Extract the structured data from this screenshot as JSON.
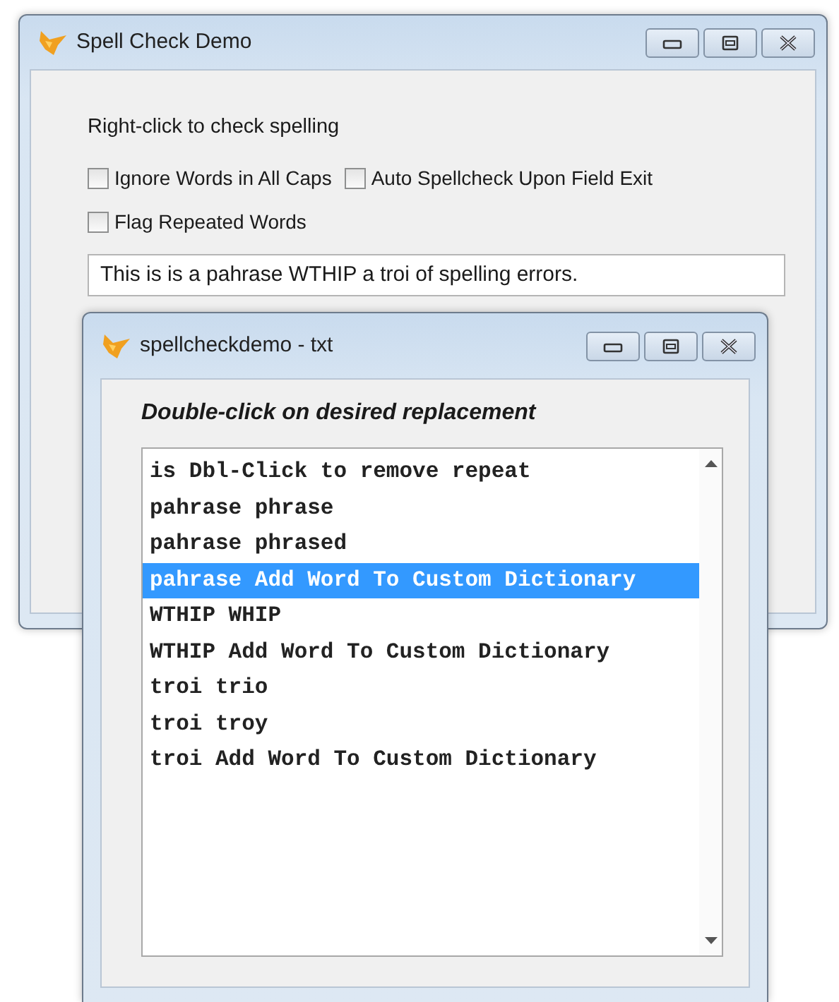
{
  "main_window": {
    "title": "Spell Check Demo",
    "instruction": "Right-click to check spelling",
    "options": [
      {
        "label": "Ignore Words in All Caps",
        "checked": false
      },
      {
        "label": "Auto Spellcheck Upon Field Exit",
        "checked": false
      },
      {
        "label": "Flag Repeated Words",
        "checked": false
      }
    ],
    "text_field": {
      "value": "This is is a pahrase WTHIP a troi of spelling errors."
    }
  },
  "dialog": {
    "title": "spellcheckdemo - txt",
    "heading": "Double-click on desired replacement",
    "suggestions": [
      {
        "text": "is Dbl-Click to remove repeat",
        "selected": false
      },
      {
        "text": "pahrase phrase",
        "selected": false
      },
      {
        "text": "pahrase phrased",
        "selected": false
      },
      {
        "text": "pahrase Add Word To Custom Dictionary",
        "selected": true
      },
      {
        "text": "WTHIP WHIP",
        "selected": false
      },
      {
        "text": "WTHIP Add Word To Custom Dictionary",
        "selected": false
      },
      {
        "text": "troi trio",
        "selected": false
      },
      {
        "text": "troi troy",
        "selected": false
      },
      {
        "text": "troi Add Word To Custom Dictionary",
        "selected": false
      }
    ]
  }
}
